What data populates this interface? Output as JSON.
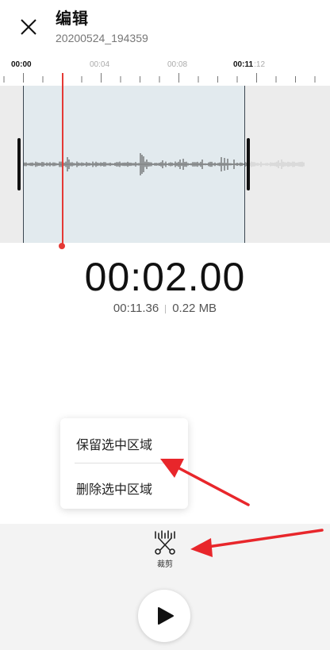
{
  "header": {
    "title": "编辑",
    "filename": "20200524_194359"
  },
  "ruler": {
    "labels": [
      "00:00",
      "00:04",
      "00:08",
      "00:11",
      "00:12"
    ]
  },
  "selection": {
    "start_label": "00:00",
    "end_label": "00:11"
  },
  "playback": {
    "current_time": "00:02.00",
    "duration": "00:11.36",
    "file_size": "0.22 MB"
  },
  "menu": {
    "keep_label": "保留选中区域",
    "delete_label": "删除选中区域"
  },
  "toolbar": {
    "trim_label": "裁剪",
    "trim_icon": "scissors-trim-icon",
    "play_icon": "play-icon"
  },
  "colors": {
    "playhead": "#e53935",
    "selection_fill": "#e2eaee",
    "wave_bg": "#ececec",
    "arrow": "#e8262b"
  }
}
